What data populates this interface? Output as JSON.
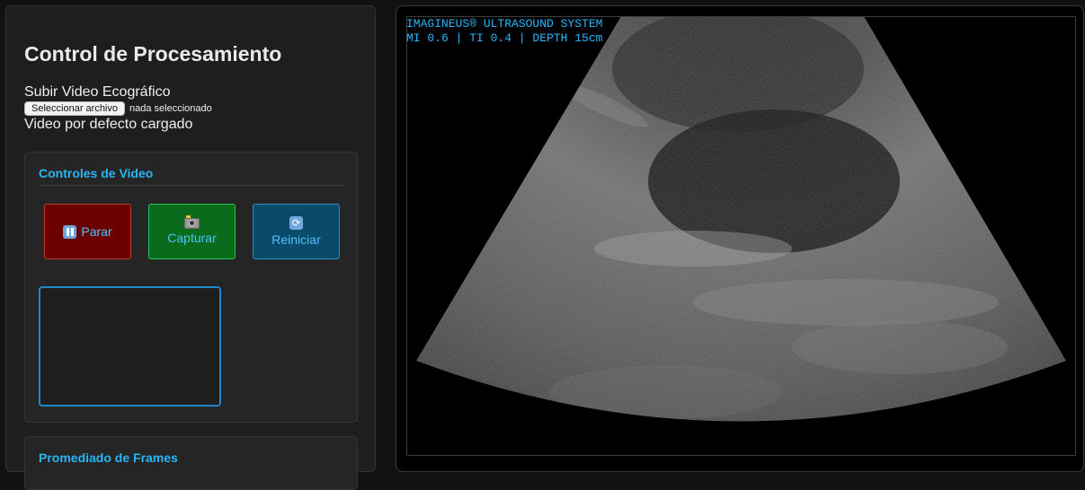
{
  "panel": {
    "title": "Control de Procesamiento",
    "upload_label": "Subir Video Ecográfico",
    "file_button": "Seleccionar archivo",
    "file_status": "nada seleccionado",
    "loaded_message": "Video por defecto cargado"
  },
  "video_controls": {
    "title": "Controles de Video",
    "stop_label": "Parar",
    "capture_label": "Capturar",
    "reset_label": "Reiniciar"
  },
  "frame_averaging": {
    "title": "Promediado de Frames"
  },
  "viewer": {
    "overlay_line1": "IMAGINEUS® ULTRASOUND SYSTEM",
    "overlay_line2": "MI 0.6 | TI 0.4 | DEPTH 15cm"
  },
  "colors": {
    "accent": "#29b6f6",
    "stop": "#6b0000",
    "capture": "#0a6b1d",
    "reset": "#0a4a6b"
  },
  "icons": {
    "stop": "pause-icon",
    "capture": "camera-icon",
    "reset": "reset-icon"
  }
}
